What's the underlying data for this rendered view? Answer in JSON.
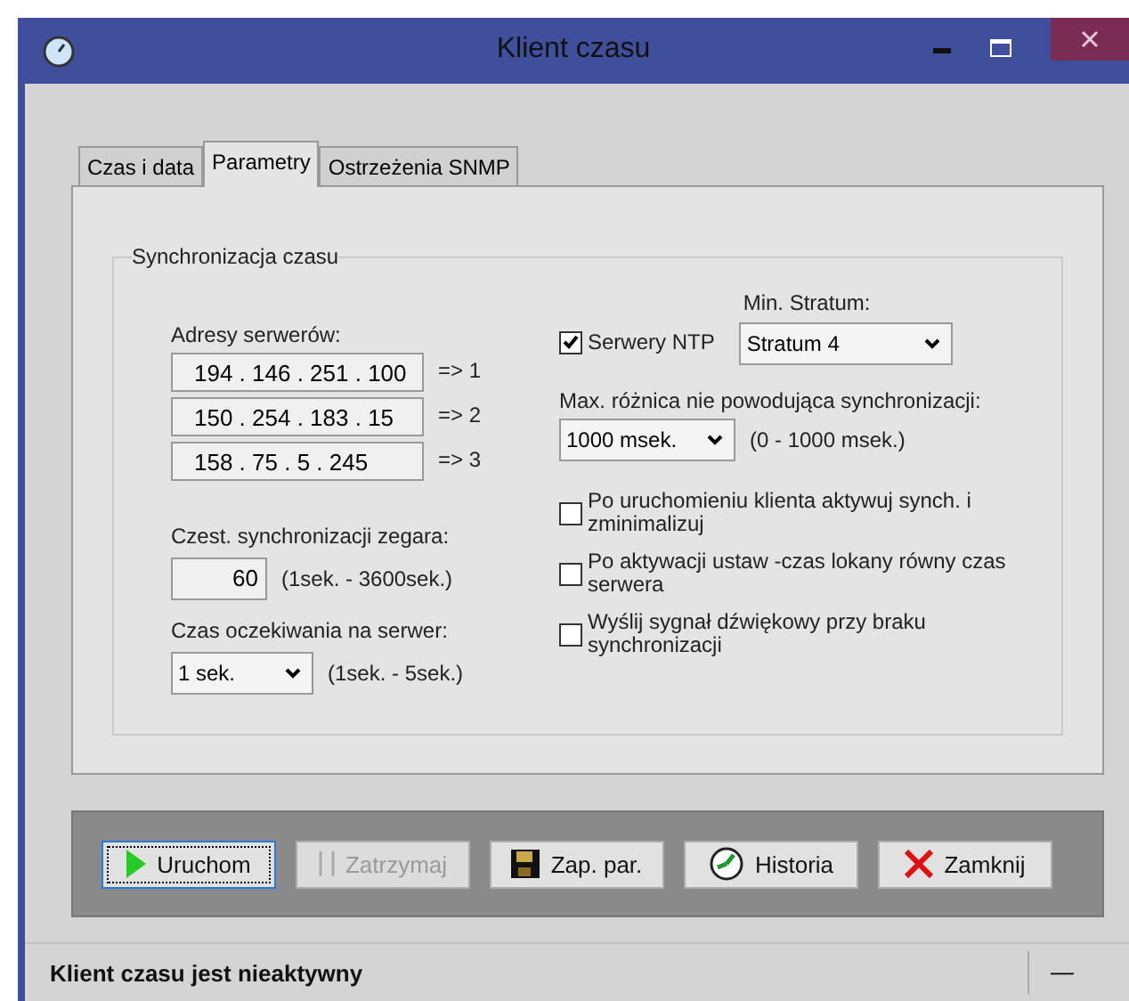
{
  "window": {
    "title": "Klient czasu"
  },
  "tabs": [
    {
      "label": "Czas i data",
      "selected": false
    },
    {
      "label": "Parametry",
      "selected": true
    },
    {
      "label": "Ostrzeżenia SNMP",
      "selected": false
    }
  ],
  "group": {
    "title": "Synchronizacja czasu",
    "servers_label": "Adresy serwerów:",
    "servers": [
      {
        "address": "194 . 146 . 251 . 100",
        "index": "=> 1"
      },
      {
        "address": "150 . 254 . 183 . 15",
        "index": "=> 2"
      },
      {
        "address": "158 . 75 . 5 . 245",
        "index": "=> 3"
      }
    ],
    "frequency": {
      "label": "Czest. synchronizacji zegara:",
      "value": "60",
      "range": "(1sek. - 3600sek.)"
    },
    "timeout": {
      "label": "Czas oczekiwania na serwer:",
      "value": "1 sek.",
      "range": "(1sek. - 5sek.)"
    },
    "ntp": {
      "label": "Serwery NTP",
      "checked": true
    },
    "stratum": {
      "label": "Min. Stratum:",
      "value": "Stratum 4"
    },
    "max_diff": {
      "label": "Max. różnica nie powodująca synchronizacji:",
      "value": "1000 msek.",
      "range": "(0 - 1000 msek.)"
    },
    "options": [
      {
        "label": "Po uruchomieniu klienta aktywuj synch. i zminimalizuj",
        "checked": false
      },
      {
        "label": "Po aktywacji  ustaw -czas lokany równy czas serwera",
        "checked": false
      },
      {
        "label": "Wyślij sygnał dźwiękowy przy braku synchronizacji",
        "checked": false
      }
    ]
  },
  "buttons": [
    {
      "kind": "play",
      "label": "Uruchom",
      "disabled": false,
      "focused": true
    },
    {
      "kind": "pause",
      "label": "Zatrzymaj",
      "disabled": true,
      "focused": false
    },
    {
      "kind": "save",
      "label": "Zap. par.",
      "disabled": false,
      "focused": false
    },
    {
      "kind": "history",
      "label": "Historia",
      "disabled": false,
      "focused": false
    },
    {
      "kind": "close",
      "label": "Zamknij",
      "disabled": false,
      "focused": false
    }
  ],
  "status_bar": {
    "text": "Klient czasu jest nieaktywny",
    "panel_2": "—"
  }
}
